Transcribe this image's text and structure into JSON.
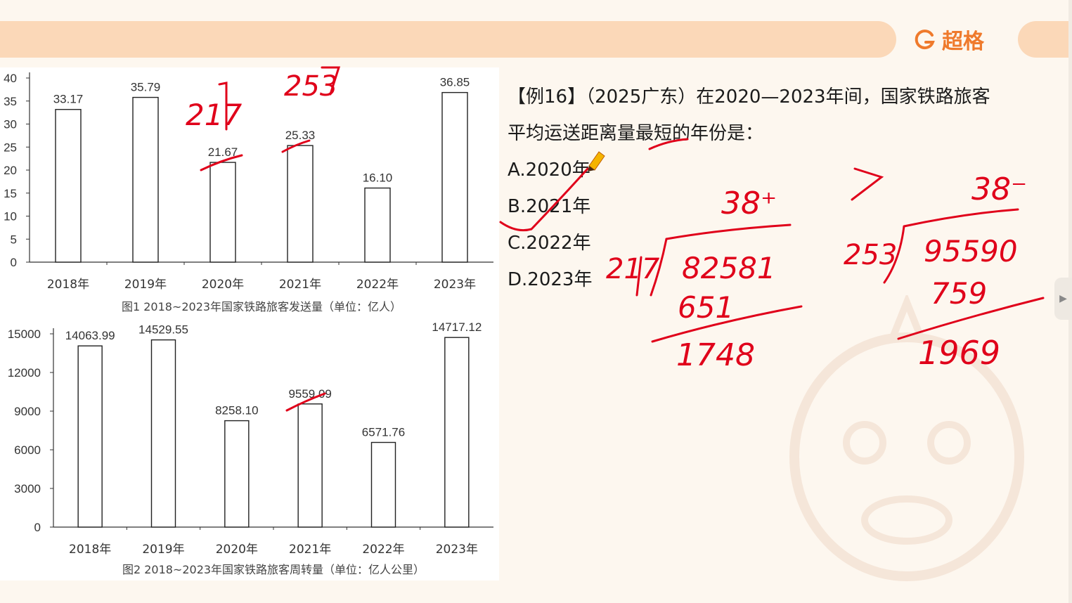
{
  "header": {
    "brand_name": "超格",
    "brand_color": "#ef7a2c",
    "bar_color": "#fbd8b8"
  },
  "question": {
    "line1": "【例16】（2025广东）在2020—2023年间，国家铁路旅客",
    "line2": "平均运送距离量最短的年份是：",
    "options": [
      {
        "label": "A.2020年"
      },
      {
        "label": "B.2021年"
      },
      {
        "label": "C.2022年"
      },
      {
        "label": "D.2023年"
      }
    ]
  },
  "annotations": {
    "chart1_top_notes": [
      "217",
      "253"
    ],
    "calc_left": {
      "quotient": "38⁺",
      "divisor": "217",
      "dividend": "82581",
      "sub": "651",
      "remainder": "1748"
    },
    "calc_right": {
      "quotient": "38⁻",
      "divisor": "253",
      "dividend": "95590",
      "sub": "759",
      "remainder": "1969"
    },
    "compare_symbol": ">",
    "ink_color": "#e0001a"
  },
  "chart_data": [
    {
      "type": "bar",
      "categories": [
        "2018年",
        "2019年",
        "2020年",
        "2021年",
        "2022年",
        "2023年"
      ],
      "values": [
        33.17,
        35.79,
        21.67,
        25.33,
        16.1,
        36.85
      ],
      "value_labels": [
        "33.17",
        "35.79",
        "21.67",
        "25.33",
        "16.10",
        "36.85"
      ],
      "y_ticks": [
        "0",
        "5",
        "10",
        "15",
        "20",
        "25",
        "30",
        "35",
        "40"
      ],
      "ylim": [
        0,
        40
      ],
      "title": "图1  2018~2023年国家铁路旅客发送量（单位：亿人）"
    },
    {
      "type": "bar",
      "categories": [
        "2018年",
        "2019年",
        "2020年",
        "2021年",
        "2022年",
        "2023年"
      ],
      "values": [
        14063.99,
        14529.55,
        8258.1,
        9559.09,
        6571.76,
        14717.12
      ],
      "value_labels": [
        "14063.99",
        "14529.55",
        "8258.10",
        "9559.09",
        "6571.76",
        "14717.12"
      ],
      "y_ticks": [
        "0",
        "3000",
        "6000",
        "9000",
        "12000",
        "15000"
      ],
      "ylim": [
        0,
        15000
      ],
      "title": "图2  2018~2023年国家铁路旅客周转量（单位：亿人公里）"
    }
  ]
}
